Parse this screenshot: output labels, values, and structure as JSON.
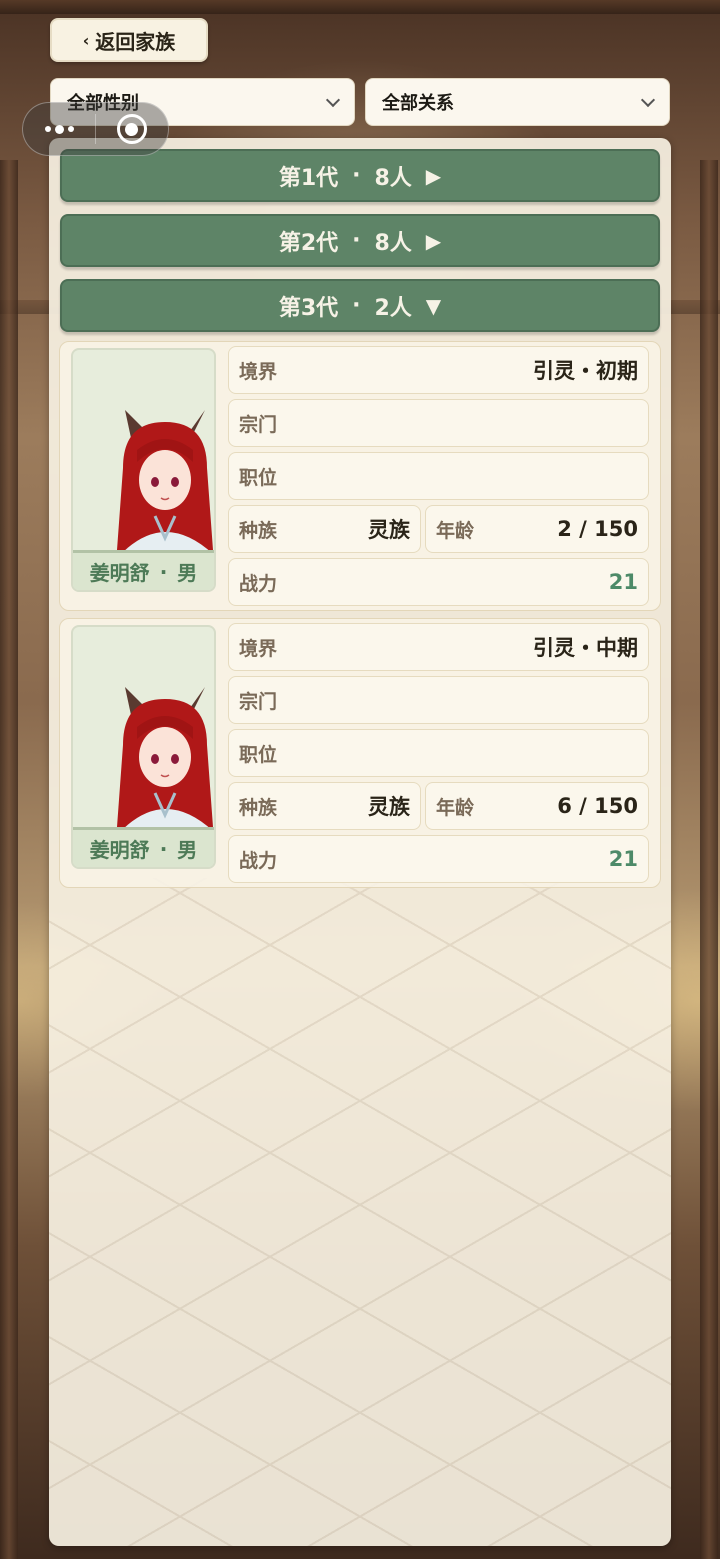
{
  "nav": {
    "back_label": "返回家族",
    "back_chevron": "‹"
  },
  "filters": {
    "gender": "全部性别",
    "relation": "全部关系"
  },
  "generations": [
    {
      "label": "第1代",
      "sep": "·",
      "count": "8人",
      "arrow": "▶"
    },
    {
      "label": "第2代",
      "sep": "·",
      "count": "8人",
      "arrow": "▶"
    },
    {
      "label": "第3代",
      "sep": "·",
      "count": "2人",
      "arrow": "▼"
    }
  ],
  "field_labels": {
    "realm": "境界",
    "sect": "宗门",
    "position": "职位",
    "race": "种族",
    "age": "年龄",
    "power": "战力"
  },
  "members": [
    {
      "name": "姜明舒",
      "sep": "·",
      "gender": "男",
      "realm": "引灵・初期",
      "sect": "",
      "position": "",
      "race": "灵族",
      "age": "2 / 150",
      "power": "21"
    },
    {
      "name": "姜明舒",
      "sep": "·",
      "gender": "男",
      "realm": "引灵・中期",
      "sect": "",
      "position": "",
      "race": "灵族",
      "age": "6 / 150",
      "power": "21"
    }
  ],
  "colors": {
    "gen_header": "#5e8467",
    "accent_green": "#4d8a68",
    "panel": "#f6f0e1"
  }
}
